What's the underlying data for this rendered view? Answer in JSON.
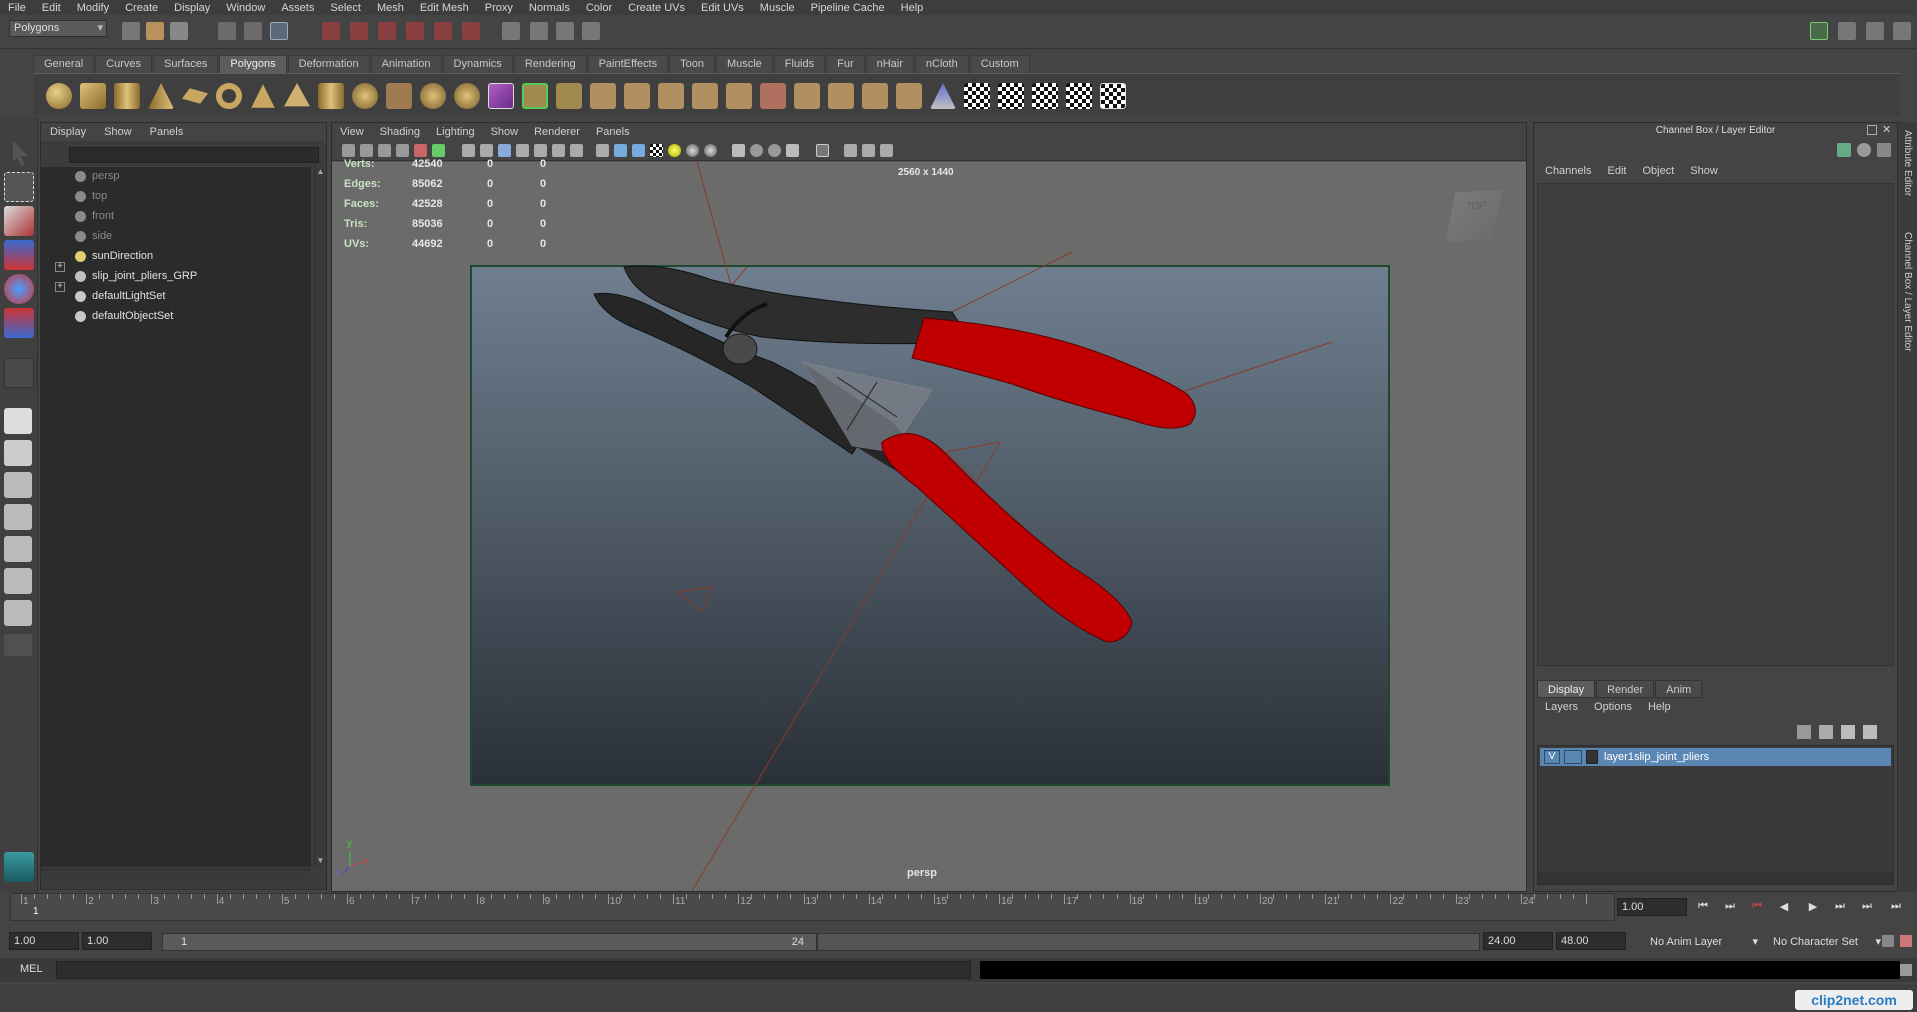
{
  "menubar": [
    "File",
    "Edit",
    "Modify",
    "Create",
    "Display",
    "Window",
    "Assets",
    "Select",
    "Mesh",
    "Edit Mesh",
    "Proxy",
    "Normals",
    "Color",
    "Create UVs",
    "Edit UVs",
    "Muscle",
    "Pipeline Cache",
    "Help"
  ],
  "status": {
    "mode": "Polygons"
  },
  "shelf_tabs": [
    "General",
    "Curves",
    "Surfaces",
    "Polygons",
    "Deformation",
    "Animation",
    "Dynamics",
    "Rendering",
    "PaintEffects",
    "Toon",
    "Muscle",
    "Fluids",
    "Fur",
    "nHair",
    "nCloth",
    "Custom"
  ],
  "shelf_active": "Polygons",
  "outliner": {
    "menu": [
      "Display",
      "Show",
      "Panels"
    ],
    "items": [
      {
        "label": "persp",
        "icon": "camera-icon",
        "dim": true
      },
      {
        "label": "top",
        "icon": "camera-icon",
        "dim": true
      },
      {
        "label": "front",
        "icon": "camera-icon",
        "dim": true
      },
      {
        "label": "side",
        "icon": "camera-icon",
        "dim": true
      },
      {
        "label": "sunDirection",
        "icon": "light-icon",
        "dim": false
      },
      {
        "label": "slip_joint_pliers_GRP",
        "icon": "group-icon",
        "dim": false
      },
      {
        "label": "defaultLightSet",
        "icon": "set-icon",
        "dim": false
      },
      {
        "label": "defaultObjectSet",
        "icon": "set-icon",
        "dim": false
      }
    ]
  },
  "viewport": {
    "menu": [
      "View",
      "Shading",
      "Lighting",
      "Show",
      "Renderer",
      "Panels"
    ],
    "hud": [
      {
        "label": "Verts:",
        "v1": "42540",
        "v2": "0",
        "v3": "0"
      },
      {
        "label": "Edges:",
        "v1": "85062",
        "v2": "0",
        "v3": "0"
      },
      {
        "label": "Faces:",
        "v1": "42528",
        "v2": "0",
        "v3": "0"
      },
      {
        "label": "Tris:",
        "v1": "85036",
        "v2": "0",
        "v3": "0"
      },
      {
        "label": "UVs:",
        "v1": "44692",
        "v2": "0",
        "v3": "0"
      }
    ],
    "resolution": "2560 x 1440",
    "camera": "persp",
    "cube_label": "TOP",
    "axis": {
      "x": "x",
      "y": "y",
      "z": "z"
    }
  },
  "channelbox": {
    "title": "Channel Box / Layer Editor",
    "menu": [
      "Channels",
      "Edit",
      "Object",
      "Show"
    ],
    "layer_tabs": [
      "Display",
      "Render",
      "Anim"
    ],
    "layer_menu": [
      "Layers",
      "Options",
      "Help"
    ],
    "layer": {
      "visible": "V",
      "name": "layer1slip_joint_pliers"
    }
  },
  "sidetabs": [
    "Attribute Editor",
    "Channel Box / Layer Editor"
  ],
  "timeline": {
    "ticks": [
      "1",
      "2",
      "3",
      "4",
      "5",
      "6",
      "7",
      "8",
      "9",
      "10",
      "11",
      "12",
      "13",
      "14",
      "15",
      "16",
      "17",
      "18",
      "19",
      "20",
      "21",
      "22",
      "23",
      "24"
    ],
    "current": "1",
    "current_field": "1.00"
  },
  "range": {
    "start": "1.00",
    "start2": "1.00",
    "slider_start": "1",
    "slider_end": "24",
    "end": "24.00",
    "end2": "48.00",
    "anim_layer": "No Anim Layer",
    "char_set": "No Character Set"
  },
  "cmd": {
    "label": "MEL"
  },
  "watermark": "clip2net.com",
  "colors": {
    "accent": "#5a86b4",
    "handle": "#c00000",
    "metal": "#2b2b2b"
  }
}
